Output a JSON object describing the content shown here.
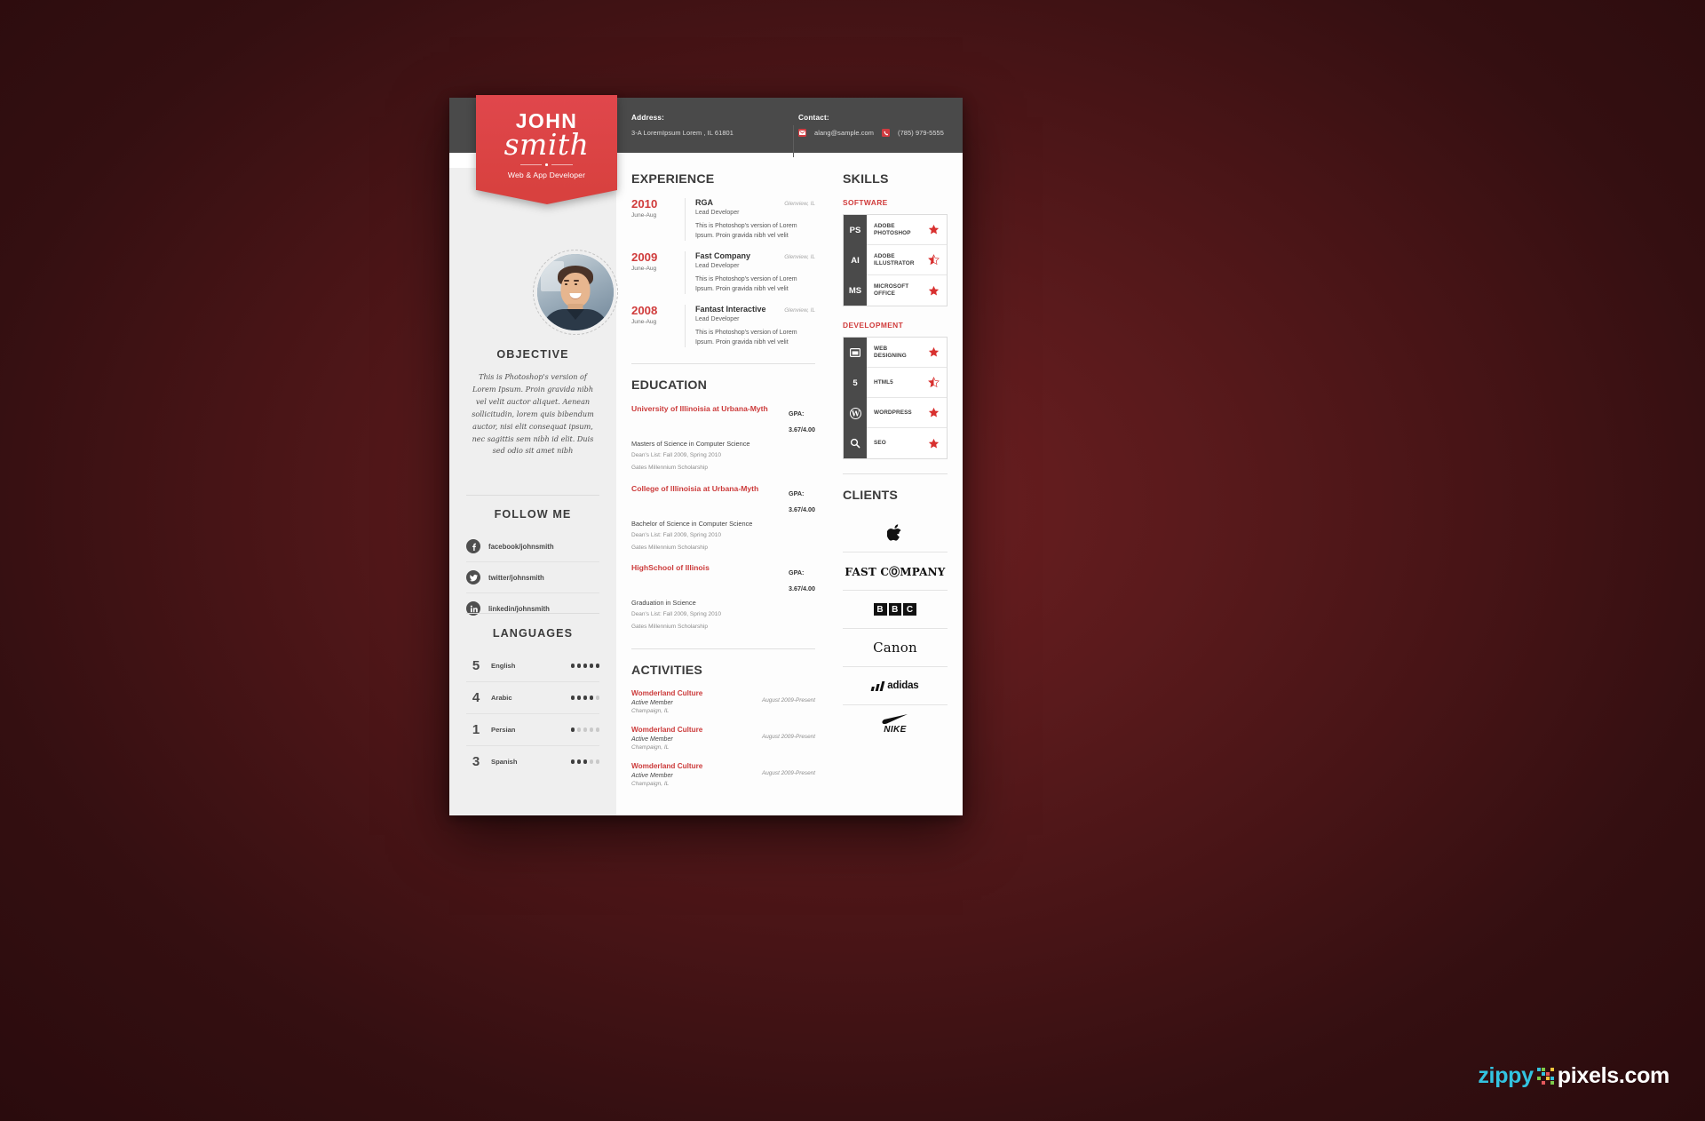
{
  "header": {
    "address_label": "Address:",
    "address_value": "3-A LoremIpsum Lorem , IL 61801",
    "contact_label": "Contact:",
    "email": "alang@sample.com",
    "phone": "(785) 979-5555"
  },
  "banner": {
    "first_name": "JOHN",
    "last_name": "smith",
    "role": "Web & App Developer"
  },
  "objective": {
    "title": "OBJECTIVE",
    "text": "This is Photoshop's version of Lorem Ipsum. Proin gravida nibh vel velit auctor aliquet. Aenean sollicitudin, lorem quis bibendum auctor, nisi elit consequat ipsum, nec sagittis sem nibh id elit. Duis sed odio sit amet nibh"
  },
  "follow": {
    "title": "FOLLOW ME",
    "items": [
      {
        "icon": "facebook-icon",
        "label": "facebook/johnsmith"
      },
      {
        "icon": "twitter-icon",
        "label": "twitter/johnsmith"
      },
      {
        "icon": "linkedin-icon",
        "label": "linkedin/johnsmith"
      }
    ]
  },
  "languages": {
    "title": "LANGUAGES",
    "items": [
      {
        "num": "5",
        "name": "English",
        "filled": 5,
        "total": 5
      },
      {
        "num": "4",
        "name": "Arabic",
        "filled": 4,
        "total": 5
      },
      {
        "num": "1",
        "name": "Persian",
        "filled": 1,
        "total": 5
      },
      {
        "num": "3",
        "name": "Spanish",
        "filled": 3,
        "total": 5
      }
    ]
  },
  "experience": {
    "title": "EXPERIENCE",
    "items": [
      {
        "year": "2010",
        "months": "June-Aug",
        "company": "RGA",
        "location": "Glenview, IL",
        "role": "Lead Developer",
        "desc": "This is Photoshop's version  of Lorem Ipsum. Proin gravida nibh vel velit"
      },
      {
        "year": "2009",
        "months": "June-Aug",
        "company": "Fast Company",
        "location": "Glenview, IL",
        "role": "Lead Developer",
        "desc": "This is Photoshop's version  of Lorem Ipsum. Proin gravida nibh vel velit"
      },
      {
        "year": "2008",
        "months": "June-Aug",
        "company": "Fantast Interactive",
        "location": "Glenview, IL",
        "role": "Lead Developer",
        "desc": "This is Photoshop's version  of Lorem Ipsum. Proin gravida nibh vel velit"
      }
    ]
  },
  "education": {
    "title": "EDUCATION",
    "gpa_label": "GPA:",
    "items": [
      {
        "school": "University of Illinoisia at Urbana-Myth",
        "degree": "Masters of Science in Computer Science",
        "note1": "Dean's List: Fall 2009, Spring 2010",
        "note2": "Gates Millennium Scholarship",
        "gpa": "3.67/4.00"
      },
      {
        "school": "College of Illinoisia at Urbana-Myth",
        "degree": "Bachelor of Science in Computer Science",
        "note1": "Dean's List: Fall 2009, Spring 2010",
        "note2": "Gates Millennium Scholarship",
        "gpa": "3.67/4.00"
      },
      {
        "school": "HighSchool of Illinois",
        "degree": "Graduation in Science",
        "note1": "Dean's List: Fall 2009, Spring 2010",
        "note2": "Gates Millennium Scholarship",
        "gpa": "3.67/4.00"
      }
    ]
  },
  "activities": {
    "title": "ACTIVITIES",
    "items": [
      {
        "name": "Womderland Culture",
        "role": "Active Member",
        "place": "Champaign, IL",
        "date": "August 2009-Present"
      },
      {
        "name": "Womderland Culture",
        "role": "Active Member",
        "place": "Champaign, IL",
        "date": "August 2009-Present"
      },
      {
        "name": "Womderland Culture",
        "role": "Active Member",
        "place": "Champaign, IL",
        "date": "August 2009-Present"
      }
    ]
  },
  "skills": {
    "title": "SKILLS",
    "groups": [
      {
        "label": "SOFTWARE",
        "items": [
          {
            "icon": "ps",
            "icon_type": "text",
            "name_line1": "ADOBE",
            "name_line2": "PHOTOSHOP",
            "rating": "full"
          },
          {
            "icon": "ai",
            "icon_type": "text",
            "name_line1": "ADOBE",
            "name_line2": "ILLUSTRATOR",
            "rating": "half"
          },
          {
            "icon": "ms",
            "icon_type": "text",
            "name_line1": "MICROSOFT",
            "name_line2": "OFFICE",
            "rating": "full"
          }
        ]
      },
      {
        "label": "DEVELOPMENT",
        "items": [
          {
            "icon": "window-icon",
            "icon_type": "glyph",
            "name_line1": "WEB",
            "name_line2": "DESIGNING",
            "rating": "full"
          },
          {
            "icon": "html5-icon",
            "icon_type": "glyph",
            "name_line1": "HTML5",
            "name_line2": "",
            "rating": "half"
          },
          {
            "icon": "wordpress-icon",
            "icon_type": "glyph",
            "name_line1": "WORDPRESS",
            "name_line2": "",
            "rating": "full"
          },
          {
            "icon": "search-icon",
            "icon_type": "glyph",
            "name_line1": "SEO",
            "name_line2": "",
            "rating": "full"
          }
        ]
      }
    ]
  },
  "clients": {
    "title": "CLIENTS",
    "items": [
      {
        "logo": "apple-logo",
        "label": ""
      },
      {
        "logo": "fast-company-logo",
        "label": "FAST CⓄMPANY"
      },
      {
        "logo": "bbc-logo",
        "label": "BBC"
      },
      {
        "logo": "canon-logo",
        "label": "Canon"
      },
      {
        "logo": "adidas-logo",
        "label": "adidas"
      },
      {
        "logo": "nike-logo",
        "label": "NIKE"
      }
    ]
  },
  "watermark": {
    "part1": "zippy",
    "part2": "pixels.com"
  },
  "colors": {
    "accent_red": "#d03b3b",
    "banner_red": "#d8413f",
    "dark_bar": "#4a4a4a",
    "page_bg": "#ffffff",
    "sidebar_bg": "#efefef"
  }
}
